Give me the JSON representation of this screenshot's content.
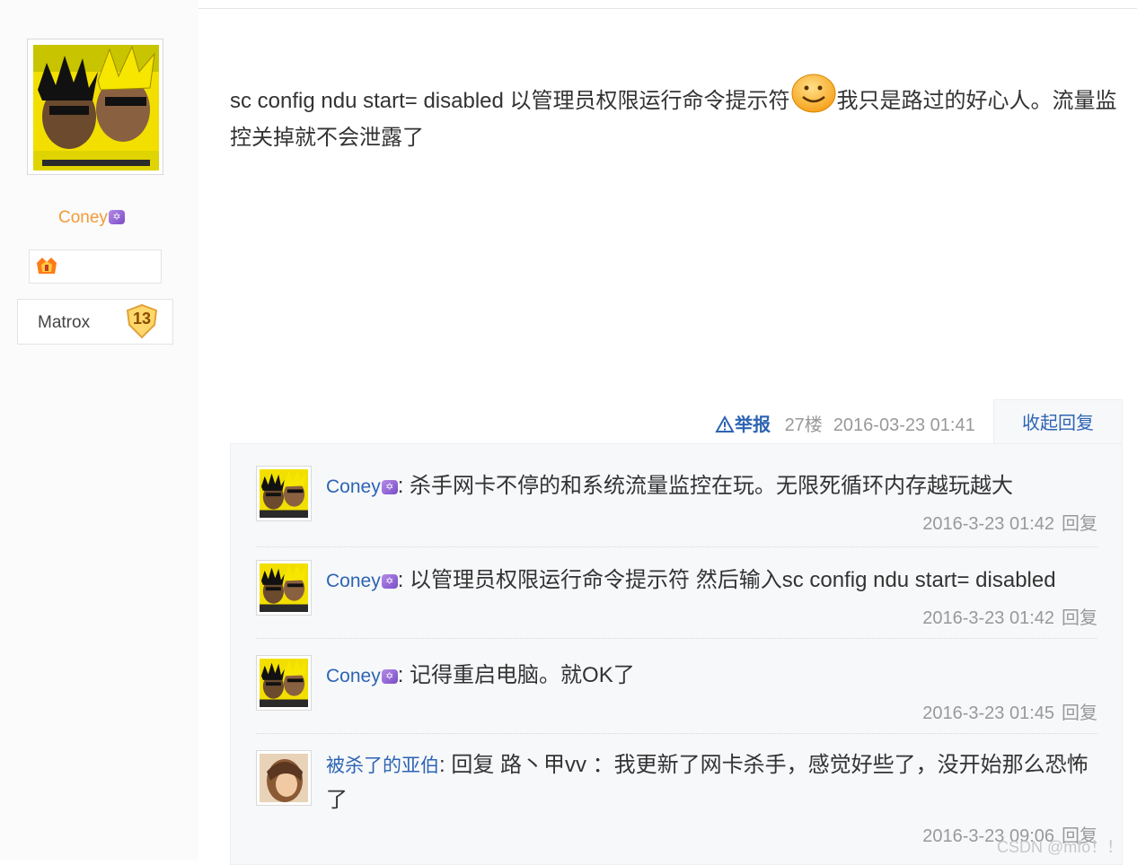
{
  "user": {
    "name": "Coney",
    "vip_badge": "✡",
    "level_title": "Matrox",
    "level_number": "13"
  },
  "post": {
    "text_before": "sc config ndu start= disabled 以管理员权限运行命令提示符",
    "text_after": "我只是路过的好心人。流量监控关掉就不会泄露了",
    "report_label": "举报",
    "floor": "27楼",
    "date": "2016-03-23 01:41",
    "collapse_label": "收起回复"
  },
  "replies": [
    {
      "name": "Coney",
      "vip_badge": "✡",
      "separator": ":",
      "text": "杀手网卡不停的和系统流量监控在玩。无限死循环内存越玩越大",
      "time": "2016-3-23 01:42",
      "reply_label": "回复"
    },
    {
      "name": "Coney",
      "vip_badge": "✡",
      "separator": ":",
      "text": "以管理员权限运行命令提示符 然后输入sc config ndu start= disabled",
      "time": "2016-3-23 01:42",
      "reply_label": "回复"
    },
    {
      "name": "Coney",
      "vip_badge": "✡",
      "separator": ":",
      "text": "记得重启电脑。就OK了",
      "time": "2016-3-23 01:45",
      "reply_label": "回复"
    },
    {
      "name": "被杀了的亚伯",
      "vip_badge": "",
      "separator": ":",
      "text": "回复 路丶甲vv ：我更新了网卡杀手，感觉好些了，没开始那么恐怖了",
      "time": "2016-3-23 09:06",
      "reply_label": "回复"
    }
  ],
  "watermark": "CSDN @mfo！！",
  "colors": {
    "link_blue": "#2d64b3",
    "username_orange": "#f39a38",
    "meta_gray": "#999999",
    "panel_bg": "#f7f8fa"
  },
  "icons": [
    "warning-triangle-icon",
    "smiley-emoticon-icon",
    "vip-star-icon",
    "medal-icon",
    "level-badge-icon"
  ]
}
